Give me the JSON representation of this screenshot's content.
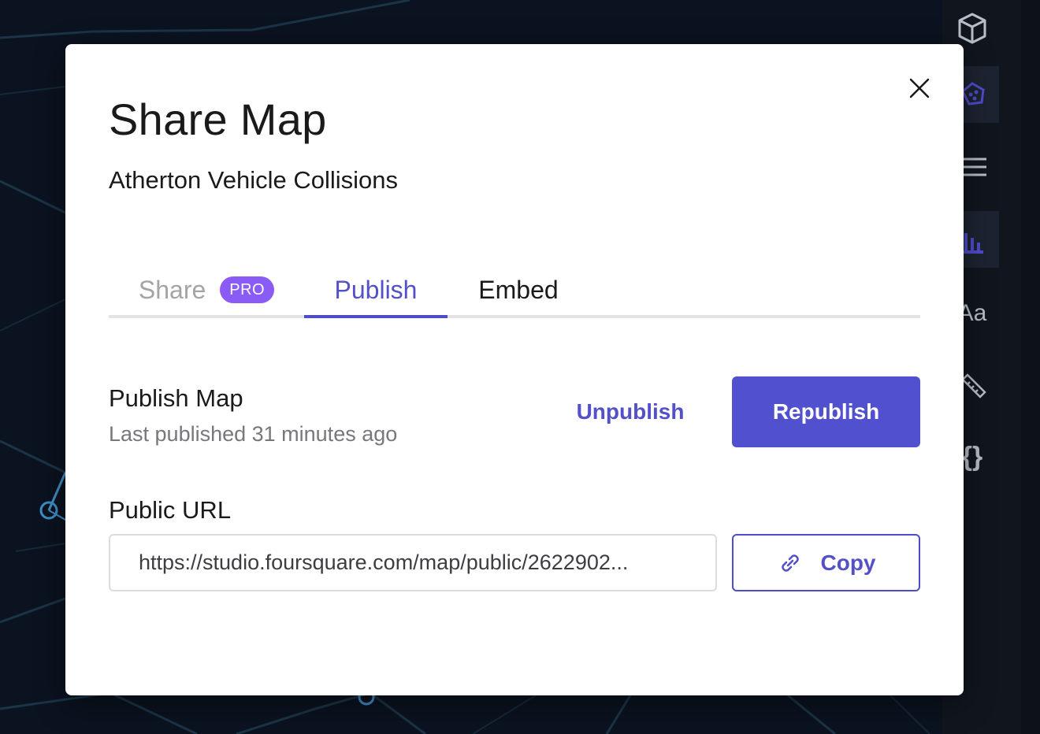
{
  "modal": {
    "title": "Share Map",
    "map_name": "Atherton Vehicle Collisions"
  },
  "tabs": [
    {
      "label": "Share",
      "badge": "PRO",
      "active": false
    },
    {
      "label": "Publish",
      "active": true
    },
    {
      "label": "Embed",
      "active": false
    }
  ],
  "publish": {
    "label": "Publish Map",
    "status": "Last published 31 minutes ago",
    "unpublish_label": "Unpublish",
    "republish_label": "Republish"
  },
  "public_url": {
    "label": "Public URL",
    "value": "https://studio.foursquare.com/map/public/2622902...",
    "copy_label": "Copy"
  },
  "toolbar": {
    "icons": [
      "cube-icon",
      "layers-icon",
      "filter-lines-icon",
      "bar-chart-icon",
      "text-aa-icon",
      "ruler-icon",
      "code-braces-icon"
    ],
    "text_tool_glyph": "Aa",
    "code_tool_glyph": "{}"
  },
  "colors": {
    "accent": "#5150cf",
    "pro_badge": "#8a5cf5",
    "map_background": "#0b1320",
    "map_roads": "#1e3a4e",
    "map_highlight": "#3f8fc8"
  }
}
